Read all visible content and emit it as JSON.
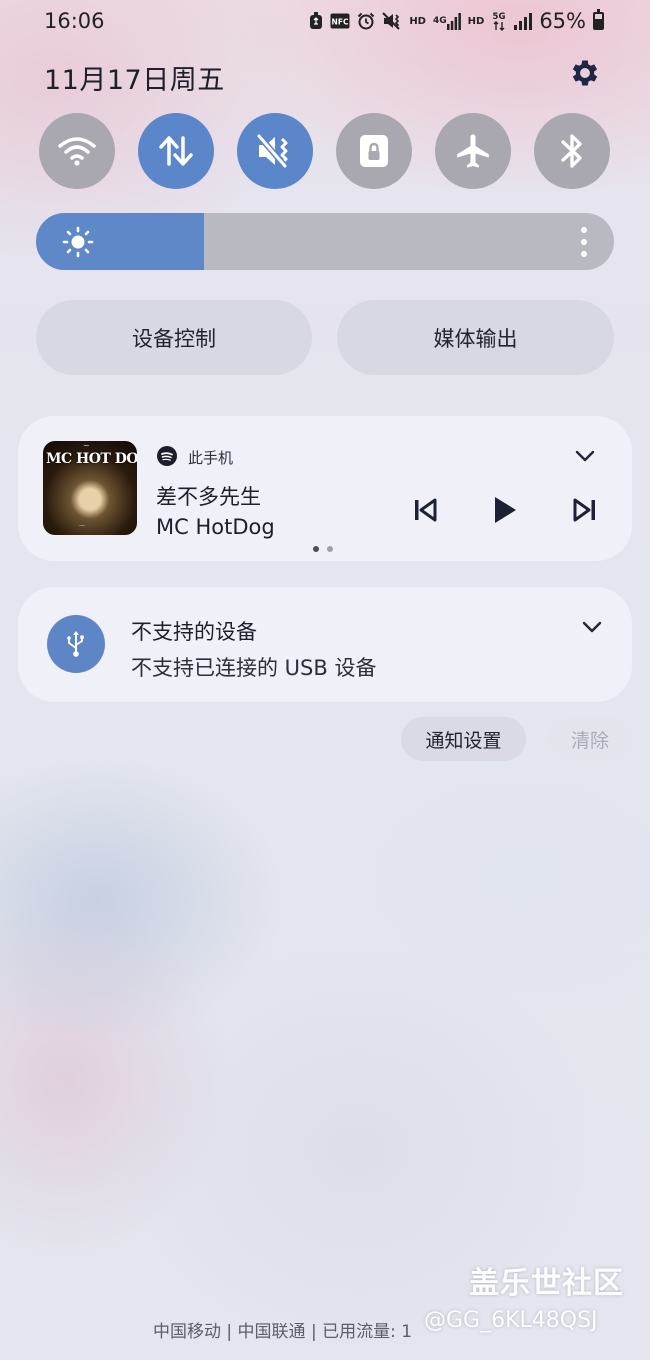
{
  "status_bar": {
    "time": "16:06",
    "icons": [
      "recycle-icon",
      "nfc-icon",
      "alarm-icon",
      "vibrate-mute-icon",
      "hd-volte-icon",
      "4g-signal-icon",
      "hd-volte-icon",
      "5g-data-icon",
      "signal-icon",
      "battery-icon"
    ],
    "nfc_label": "NFC",
    "hd_label_1": "HD",
    "net_label_1": "4G",
    "hd_label_2": "HD",
    "net_label_2": "5G",
    "battery_percent": "65%",
    "battery_level": 0.65
  },
  "header": {
    "date": "11月17日周五"
  },
  "quick_toggles": [
    {
      "name": "wifi",
      "icon": "wifi-icon",
      "state": "off"
    },
    {
      "name": "mobile-data",
      "icon": "data-arrows-icon",
      "state": "on"
    },
    {
      "name": "sound-mode",
      "icon": "vibrate-mute-icon",
      "state": "on"
    },
    {
      "name": "rotation-lock",
      "icon": "lock-icon",
      "state": "off"
    },
    {
      "name": "airplane-mode",
      "icon": "airplane-icon",
      "state": "off"
    },
    {
      "name": "bluetooth",
      "icon": "bluetooth-icon",
      "state": "off"
    }
  ],
  "brightness": {
    "level": 0.29
  },
  "panels": {
    "device_control": "设备控制",
    "media_output": "媒体输出"
  },
  "media": {
    "source_icon": "spotify-icon",
    "source": "此手机",
    "title": "差不多先生",
    "artist": "MC HotDog",
    "album_art_text": "MC HOT DOG",
    "pages": 2,
    "current_page": 1,
    "accent": "#1c1f2b"
  },
  "notification": {
    "icon": "usb-icon",
    "title": "不支持的设备",
    "text": "不支持已连接的 USB 设备"
  },
  "actions": {
    "notification_settings": "通知设置",
    "clear": "清除"
  },
  "footer": {
    "carrier_info": "中国移动 | 中国联通 | 已用流量: 1",
    "watermark_brand": "盖乐世社区",
    "watermark_user": "@GG_6KL48QSJ"
  },
  "colors": {
    "toggle_on": "#5b86c9",
    "toggle_off": "#a9a8b1",
    "brightness_fill": "#5f88c9"
  }
}
